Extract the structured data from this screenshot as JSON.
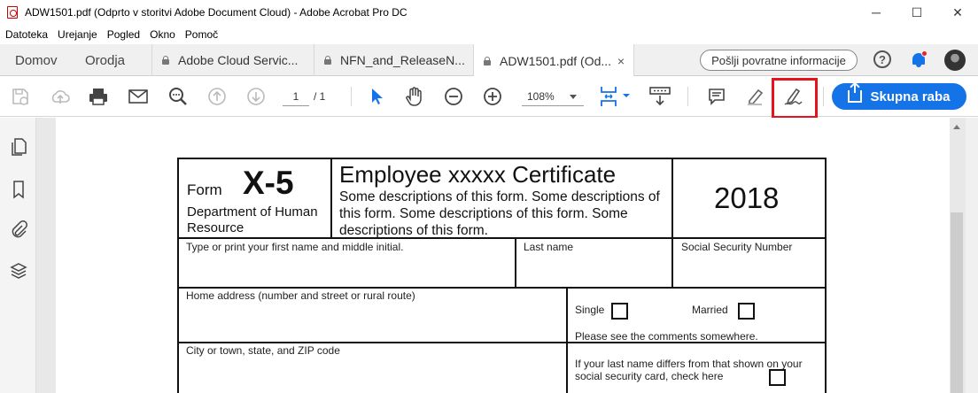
{
  "window": {
    "title": "ADW1501.pdf (Odprto v storitvi Adobe Document Cloud) - Adobe Acrobat Pro DC",
    "minimize": "─",
    "maximize": "☐",
    "close": "✕"
  },
  "menu": [
    "Datoteka",
    "Urejanje",
    "Pogled",
    "Okno",
    "Pomoč"
  ],
  "tabs": {
    "home": "Domov",
    "tools": "Orodja",
    "documents": [
      {
        "label": "Adobe Cloud Servic..."
      },
      {
        "label": "NFN_and_ReleaseN..."
      },
      {
        "label": "ADW1501.pdf (Od..."
      }
    ],
    "close": "×"
  },
  "header": {
    "feedback_label": "Pošlji povratne informacije",
    "help": "?"
  },
  "toolbar": {
    "page_current": "1",
    "page_total": "/ 1",
    "zoom": "108%",
    "share_label": "Skupna raba",
    "highlight_color": "#e8121b",
    "accent": "#1473e6"
  },
  "form": {
    "form_word": "Form",
    "form_number": "X-5",
    "department": "Department of Human Resource",
    "title": "Employee xxxxx Certificate",
    "description": "Some descriptions of this form. Some descriptions of this form. Some descriptions of this form. Some descriptions of this form.",
    "year": "2018",
    "first_name_label": "Type or print your first name and middle initial.",
    "last_name_label": "Last name",
    "ssn_label": "Social Security Number",
    "address_label": "Home address (number and street or rural route)",
    "single_label": "Single",
    "married_label": "Married",
    "comments_note": "Please see the comments somewhere.",
    "city_label": "City or town, state, and ZIP code",
    "last_name_differs": "If your last name differs from that shown on your social security card, check here"
  }
}
